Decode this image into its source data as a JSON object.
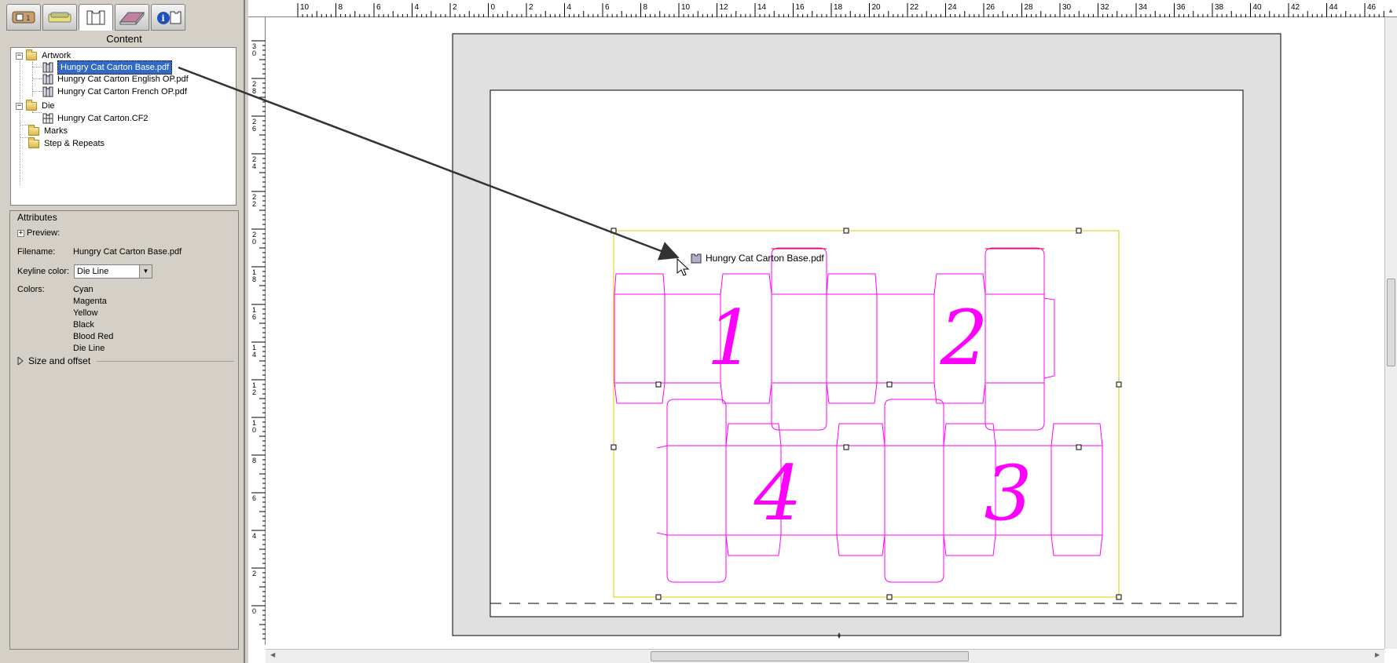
{
  "tabs": [
    {
      "name": "job-info-icon"
    },
    {
      "name": "tickets-icon"
    },
    {
      "name": "content-icon",
      "active": true
    },
    {
      "name": "layout-icon"
    },
    {
      "name": "info-icon"
    }
  ],
  "content_header": "Content",
  "tree": {
    "artwork": {
      "label": "Artwork",
      "files": [
        "Hungry Cat Carton Base.pdf",
        "Hungry Cat Carton English OP.pdf",
        "Hungry Cat Carton French OP.pdf"
      ]
    },
    "die": {
      "label": "Die",
      "files": [
        "Hungry Cat Carton.CF2"
      ]
    },
    "marks": {
      "label": "Marks"
    },
    "step_repeats": {
      "label": "Step & Repeats"
    }
  },
  "attributes": {
    "title": "Attributes",
    "preview_label": "Preview:",
    "filename_label": "Filename:",
    "filename_value": "Hungry Cat Carton Base.pdf",
    "keyline_label": "Keyline color:",
    "keyline_value": "Die Line",
    "colors_label": "Colors:",
    "colors": [
      "Cyan",
      "Magenta",
      "Yellow",
      "Black",
      "Blood Red",
      "Die Line"
    ],
    "size_offset_label": "Size and offset"
  },
  "canvas": {
    "drag_label": "Hungry Cat Carton Base.pdf",
    "step_numbers": [
      "1",
      "2",
      "4",
      "3"
    ],
    "ruler_top_labels": [
      "10",
      "8",
      "6",
      "4",
      "2",
      "0",
      "2",
      "4",
      "6",
      "8",
      "10",
      "12",
      "14",
      "16",
      "18",
      "20",
      "22",
      "24",
      "26",
      "28",
      "30",
      "32",
      "34",
      "36",
      "38",
      "40",
      "42",
      "44",
      "46"
    ],
    "ruler_left_labels": [
      "30",
      "28",
      "26",
      "24",
      "22",
      "20",
      "18",
      "16",
      "14",
      "12",
      "10",
      "8",
      "6",
      "4",
      "2",
      "0"
    ]
  },
  "colors": {
    "die_line": "#ff00ff",
    "bounding_box": "#e8c800",
    "sheet_border": "#e0e0e0",
    "selection": "#316ac5"
  }
}
